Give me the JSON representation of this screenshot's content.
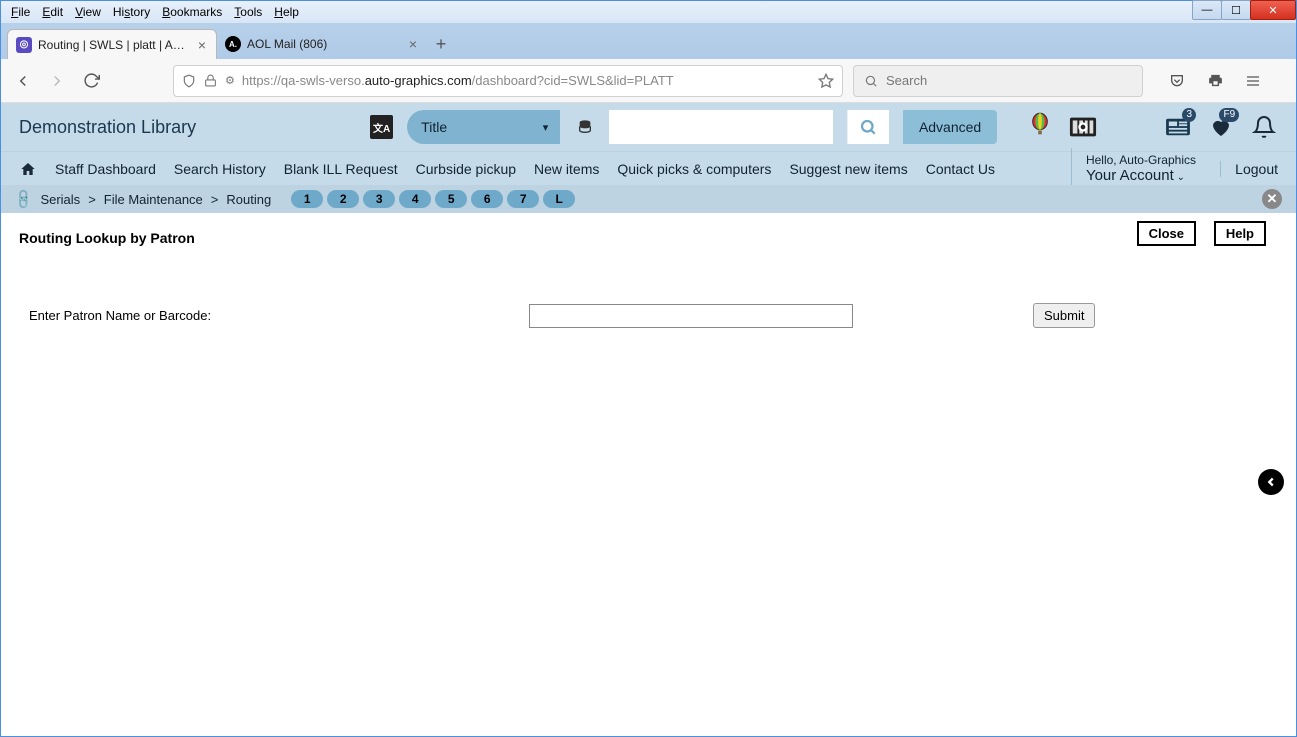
{
  "browser": {
    "menus": [
      "File",
      "Edit",
      "View",
      "History",
      "Bookmarks",
      "Tools",
      "Help"
    ],
    "tabs": [
      {
        "title": "Routing | SWLS | platt | Auto-Gr…",
        "active": true
      },
      {
        "title": "AOL Mail (806)",
        "active": false
      }
    ],
    "url_prefix": "https://qa-swls-verso.",
    "url_bold": "auto-graphics.com",
    "url_suffix": "/dashboard?cid=SWLS&lid=PLATT",
    "search_placeholder": "Search"
  },
  "app": {
    "library_name": "Demonstration Library",
    "search_type": "Title",
    "advanced": "Advanced",
    "nav_items": [
      "Staff Dashboard",
      "Search History",
      "Blank ILL Request",
      "Curbside pickup",
      "New items",
      "Quick picks & computers",
      "Suggest new items",
      "Contact Us"
    ],
    "greeting": "Hello, Auto-Graphics",
    "account_label": "Your Account",
    "logout": "Logout",
    "news_badge": "3",
    "fav_badge": "F9"
  },
  "breadcrumb": {
    "parts": [
      "Serials",
      "File Maintenance",
      "Routing"
    ],
    "pills": [
      "1",
      "2",
      "3",
      "4",
      "5",
      "6",
      "7",
      "L"
    ]
  },
  "page": {
    "title": "Routing Lookup by Patron",
    "close": "Close",
    "help": "Help",
    "field_label": "Enter Patron Name or Barcode:",
    "submit": "Submit"
  }
}
